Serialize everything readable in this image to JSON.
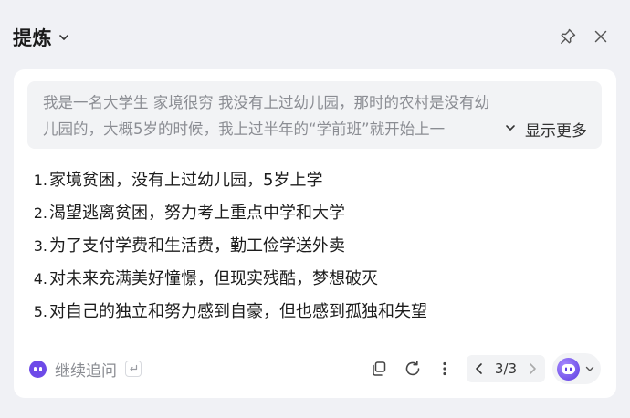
{
  "header": {
    "title": "提炼"
  },
  "source": {
    "text": "我是一名大学生 家境很穷 我没有上过幼儿园，那时的农村是没有幼儿园的，大概5岁的时候，我上过半年的“学前班”就开始上一",
    "show_more_label": "显示更多"
  },
  "results": [
    {
      "num": "1.",
      "text": "家境贫困，没有上过幼儿园，5岁上学"
    },
    {
      "num": "2.",
      "text": "渴望逃离贫困，努力考上重点中学和大学"
    },
    {
      "num": "3.",
      "text": "为了支付学费和生活费，勤工俭学送外卖"
    },
    {
      "num": "4.",
      "text": "对未来充满美好憧憬，但现实残酷，梦想破灭"
    },
    {
      "num": "5.",
      "text": "对自己的独立和努力感到自豪，但也感到孤独和失望"
    }
  ],
  "footer": {
    "followup_label": "继续追问",
    "pager": "3/3"
  },
  "colors": {
    "accent": "#6d4ae8",
    "panel_bg": "#f0f1f5",
    "source_bg": "#f2f3f5"
  }
}
